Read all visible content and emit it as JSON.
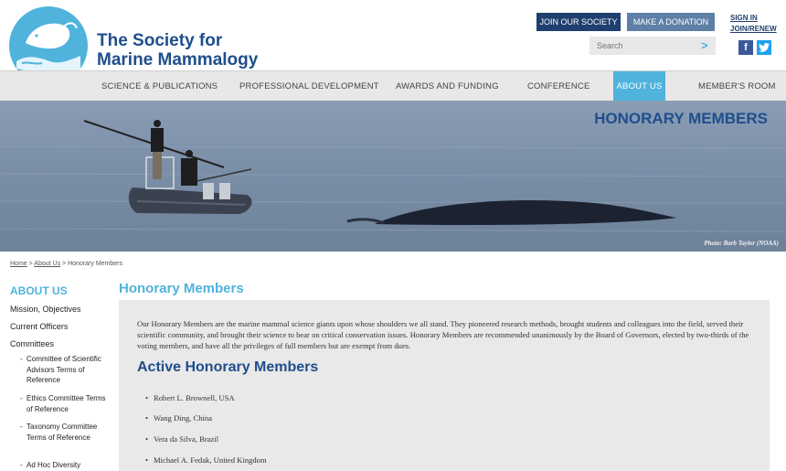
{
  "header": {
    "org_line1": "The Society for",
    "org_line2": "Marine Mammalogy",
    "join_label": "JOIN OUR SOCIETY",
    "donate_label": "MAKE A DONATION",
    "sign_in_label": "SIGN IN",
    "join_renew_label": "JOIN/RENEW",
    "search_placeholder": "Search",
    "search_arrow": ">",
    "facebook_glyph": "f",
    "twitter_glyph": "t"
  },
  "nav": {
    "items": [
      {
        "label": "SCIENCE & PUBLICATIONS"
      },
      {
        "label": "PROFESSIONAL DEVELOPMENT"
      },
      {
        "label": "AWARDS AND FUNDING"
      },
      {
        "label": "CONFERENCE"
      },
      {
        "label": "ABOUT US",
        "active": true
      },
      {
        "label": "MEMBER'S ROOM"
      }
    ]
  },
  "hero": {
    "title": "HONORARY MEMBERS",
    "photo_credit": "Photo: Barb Taylor (NOAA)"
  },
  "breadcrumb": {
    "home": "Home",
    "sep1": ">",
    "about": "About Us",
    "sep2": ">",
    "current": "Honorary Members"
  },
  "sidebar": {
    "title": "ABOUT US",
    "links": [
      "Mission, Objectives",
      "Current Officers",
      "Committees"
    ],
    "sub_links": [
      "Committee of Scientific Advisors Terms of Reference",
      "Ethics Committee Terms of Reference",
      "Taxonomy Committee Terms of Reference",
      "Ad Hoc Diversity"
    ]
  },
  "main": {
    "title": "Honorary Members",
    "intro": "Our Honorary Members are the marine mammal science giants upon whose shoulders we all stand. They pioneered research methods, brought students and colleagues into the field, served their scientific community, and brought their science to bear on critical conservation issues. Honorary Members are recommended unanimously by the Board of Governors, elected by two-thirds of the voting members, and have all the privileges of full members but are exempt from dues.",
    "active_title": "Active Honorary Members",
    "members": [
      "Robert L. Brownell, USA",
      "Wang Ding, China",
      "Vera da Silva, Brazil",
      "Michael A. Fedak, United Kingdom"
    ]
  },
  "colors": {
    "brand_dark": "#1f4e8c",
    "brand_light": "#4fb3dc",
    "nav_bg": "#e8e8e8",
    "content_bg": "#e9e9e9"
  }
}
